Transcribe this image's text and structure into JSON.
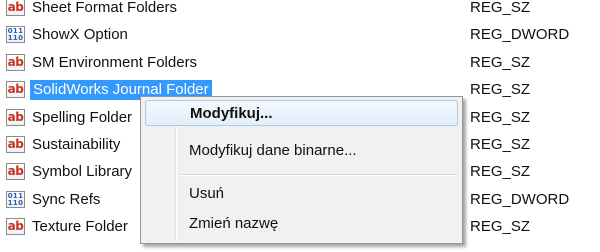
{
  "rows": [
    {
      "name": "Sheet Format Folders",
      "type": "REG_SZ",
      "icon": "string-value-icon"
    },
    {
      "name": "ShowX Option",
      "type": "REG_DWORD",
      "icon": "binary-value-icon"
    },
    {
      "name": "SM Environment Folders",
      "type": "REG_SZ",
      "icon": "string-value-icon"
    },
    {
      "name": "SolidWorks Journal Folder",
      "type": "REG_SZ",
      "icon": "string-value-icon",
      "selected": true
    },
    {
      "name": "Spelling Folder",
      "type": "REG_SZ",
      "icon": "string-value-icon"
    },
    {
      "name": "Sustainability",
      "type": "REG_SZ",
      "icon": "string-value-icon"
    },
    {
      "name": "Symbol Library",
      "type": "REG_SZ",
      "icon": "string-value-icon"
    },
    {
      "name": "Sync Refs",
      "type": "REG_DWORD",
      "icon": "binary-value-icon"
    },
    {
      "name": "Texture Folder",
      "type": "REG_SZ",
      "icon": "string-value-icon"
    }
  ],
  "icon_text": {
    "string": "ab",
    "binary_top": "011",
    "binary_bottom": "110"
  },
  "context_menu": {
    "modify": "Modyfikuj...",
    "modify_binary": "Modyfikuj dane binarne...",
    "delete": "Usuń",
    "rename": "Zmień nazwę"
  },
  "colors": {
    "selection": "#3399ff",
    "string_icon": "#c8321e",
    "binary_icon": "#2a5cb3",
    "menu_background": "#f1f1f1",
    "menu_highlight_border": "#a8cbe8"
  }
}
